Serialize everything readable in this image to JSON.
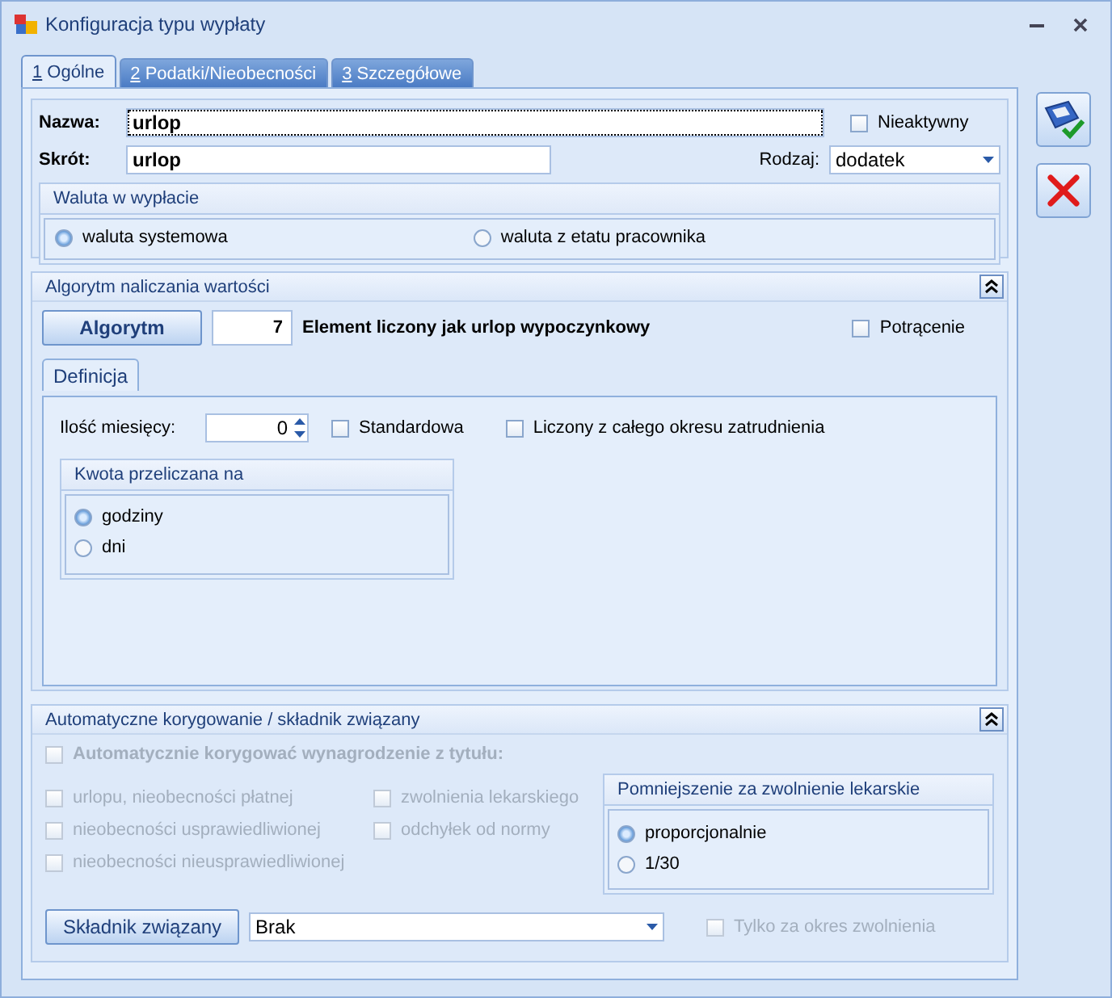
{
  "window": {
    "title": "Konfiguracja typu wypłaty"
  },
  "tabs": [
    {
      "label": "1 Ogólne",
      "selected": true
    },
    {
      "label": "2 Podatki/Nieobecności",
      "selected": false
    },
    {
      "label": "3 Szczegółowe",
      "selected": false
    }
  ],
  "general": {
    "name_label": "Nazwa:",
    "name_value": "urlop",
    "inactive": {
      "label": "Nieaktywny",
      "checked": false
    },
    "short_label": "Skrót:",
    "short_value": "urlop",
    "type_label": "Rodzaj:",
    "type_value": "dodatek",
    "currency": {
      "title": "Waluta w wypłacie",
      "options": [
        {
          "label": "waluta systemowa",
          "selected": true
        },
        {
          "label": "waluta z etatu pracownika",
          "selected": false
        }
      ]
    }
  },
  "algorithm": {
    "title": "Algorytm naliczania wartości",
    "expanded": true,
    "button": "Algorytm",
    "number": "7",
    "description": "Element liczony jak urlop wypoczynkowy",
    "deduction": {
      "label": "Potrącenie",
      "checked": false
    },
    "subtab": {
      "label": "Definicja",
      "selected": true
    },
    "months_label": "Ilość miesięcy:",
    "months_value": "0",
    "standard": {
      "label": "Standardowa",
      "checked": false
    },
    "whole_period": {
      "label": "Liczony z całego okresu zatrudnienia",
      "checked": false
    },
    "amount": {
      "title": "Kwota przeliczana na",
      "options": [
        {
          "label": "godziny",
          "selected": true
        },
        {
          "label": "dni",
          "selected": false
        }
      ]
    }
  },
  "correction": {
    "title": "Automatyczne korygowanie / składnik związany",
    "expanded": true,
    "main": {
      "label": "Automatycznie korygować wynagrodzenie z tytułu:",
      "checked": false,
      "disabled": true
    },
    "checks": [
      {
        "label": "urlopu, nieobecności płatnej",
        "checked": false,
        "disabled": true
      },
      {
        "label": "zwolnienia lekarskiego",
        "checked": false,
        "disabled": true
      },
      {
        "label": "nieobecności usprawiedliwionej",
        "checked": false,
        "disabled": true
      },
      {
        "label": "odchyłek od normy",
        "checked": false,
        "disabled": true
      },
      {
        "label": "nieobecności nieusprawiedliwionej",
        "checked": false,
        "disabled": true
      }
    ],
    "reduction": {
      "title": "Pomniejszenie za zwolnienie lekarskie",
      "options": [
        {
          "label": "proporcjonalnie",
          "selected": true
        },
        {
          "label": "1/30",
          "selected": false
        }
      ]
    },
    "linked_button": "Składnik związany",
    "linked_value": "Brak",
    "only_period": {
      "label": "Tylko za okres zwolnienia",
      "checked": false,
      "disabled": true
    }
  }
}
